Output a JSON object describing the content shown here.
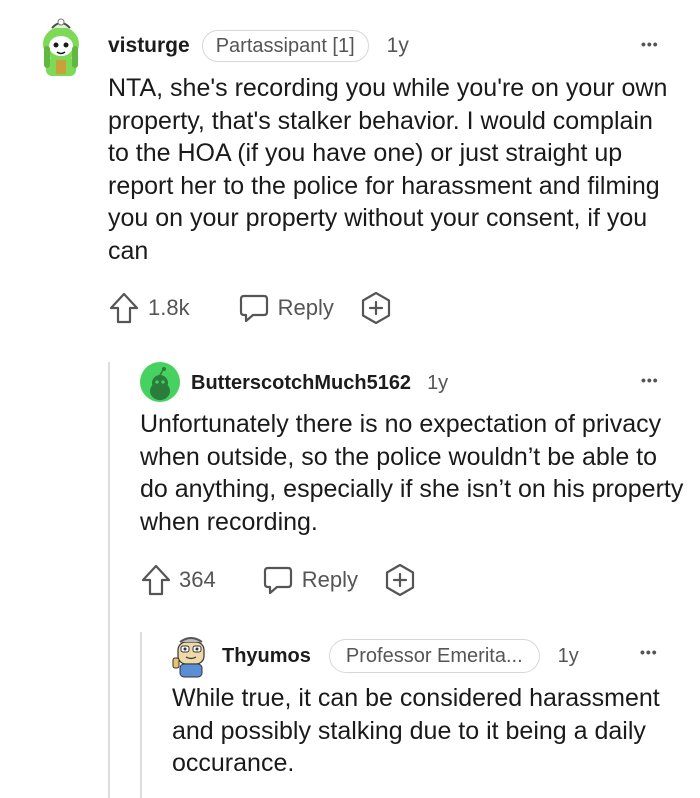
{
  "comments": [
    {
      "username": "visturge",
      "flair": "Partassipant [1]",
      "age": "1y",
      "body": "NTA, she's recording you while you're on your own property, that's stalker behavior. I would complain to the HOA (if you have one) or just straight up report her to the police for harassment and filming you on your property without your consent, if you can",
      "votes": "1.8k",
      "reply_label": "Reply",
      "more_label": "•••"
    },
    {
      "username": "ButterscotchMuch5162",
      "age": "1y",
      "body": "Unfortunately there is no expectation of privacy when outside, so the police wouldn’t be able to do anything, especially if she isn’t on his property when recording.",
      "votes": "364",
      "reply_label": "Reply",
      "more_label": "•••"
    },
    {
      "username": "Thyumos",
      "flair": "Professor Emerita...",
      "age": "1y",
      "body": "While true, it can be considered harassment and possibly stalking due to it being a daily occurance.",
      "more_label": "•••"
    }
  ],
  "colors": {
    "text": "#1a1a1b",
    "muted": "#555555",
    "thread_line": "#dcdcdc",
    "avatar_green": "#46d160"
  },
  "icons": [
    "upvote-icon",
    "reply-icon",
    "award-icon",
    "more-icon"
  ]
}
